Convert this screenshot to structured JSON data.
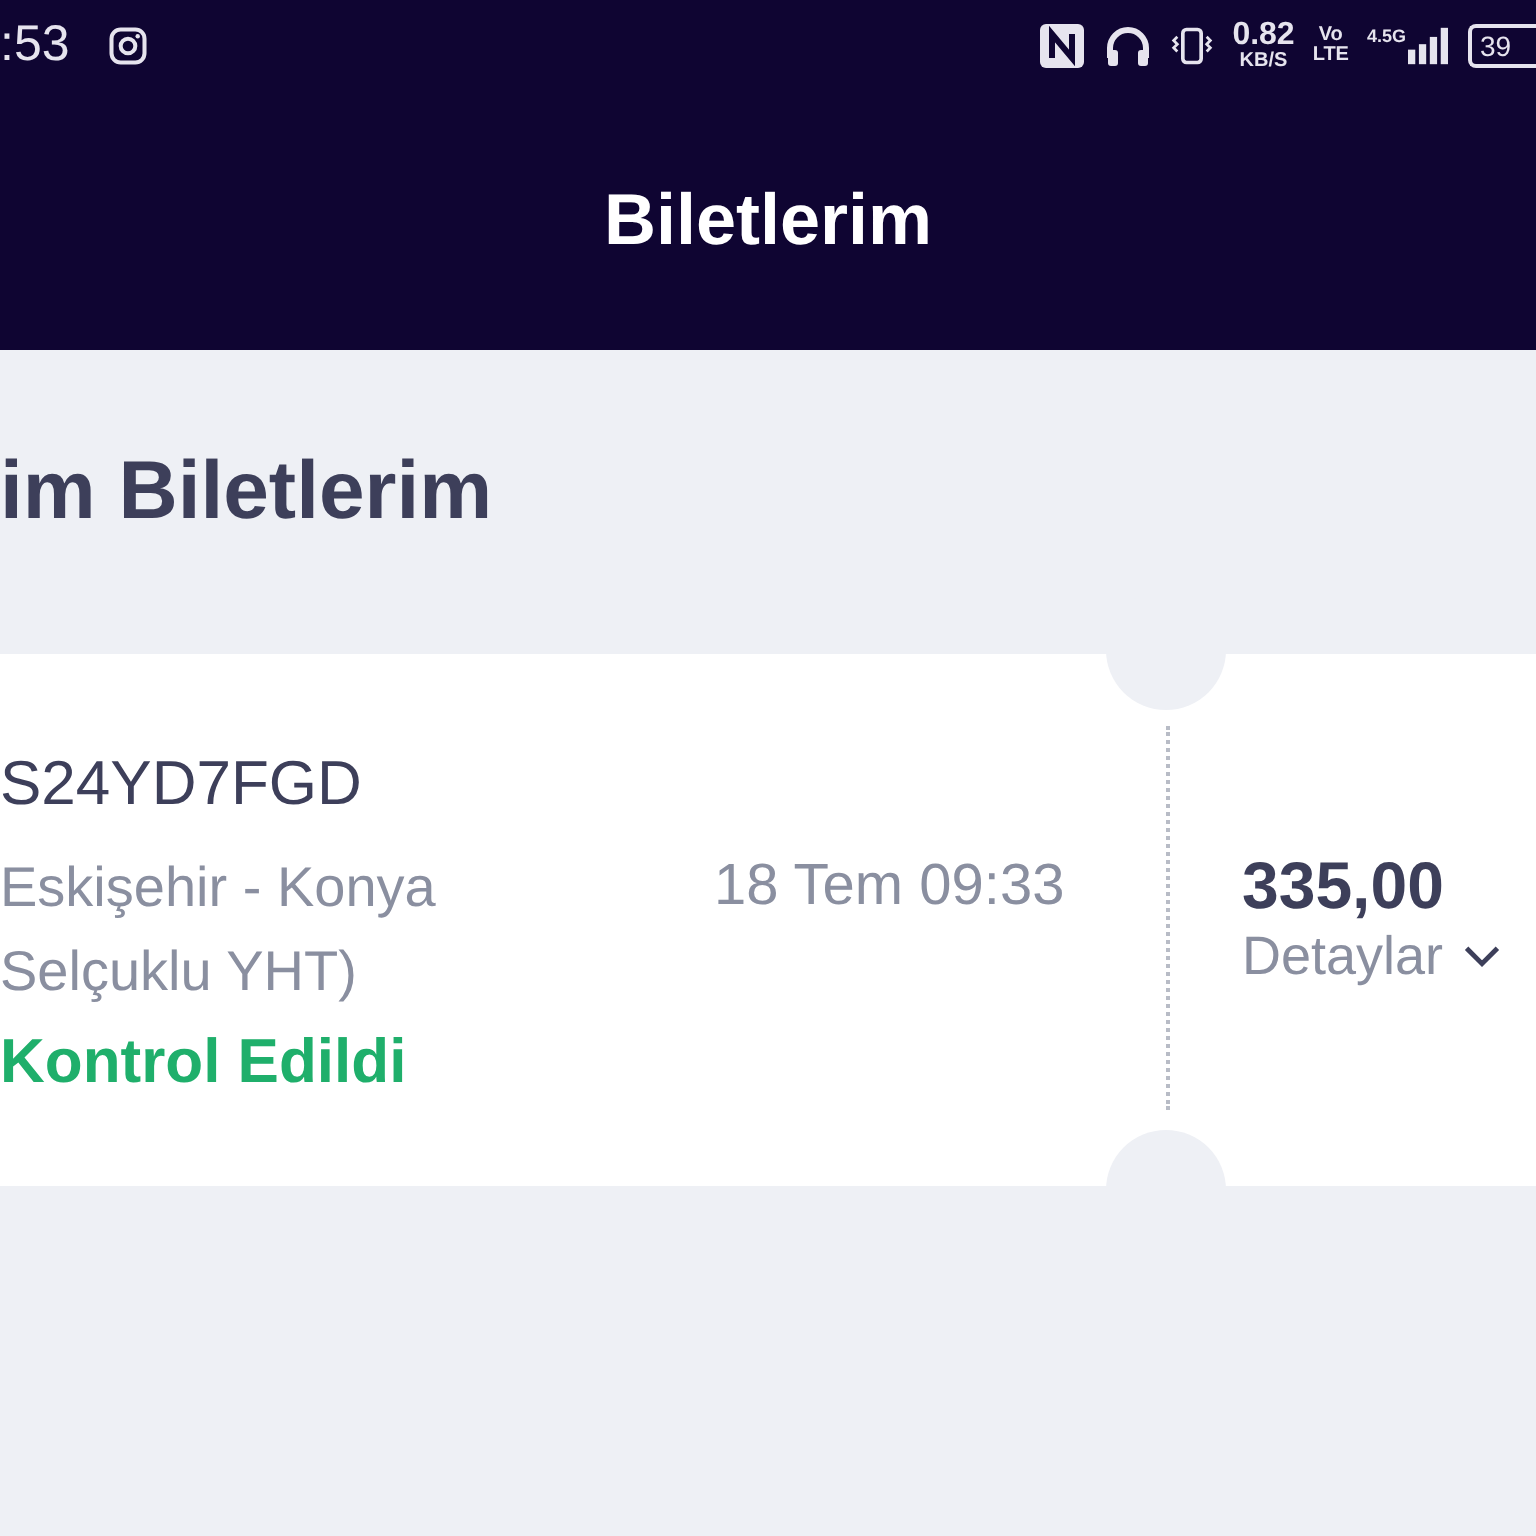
{
  "status_bar": {
    "time": ":53",
    "speed": "0.82",
    "speed_unit": "KB/S",
    "volte_top": "Vo",
    "volte_bottom": "LTE",
    "network": "4.5G",
    "battery": "39"
  },
  "header": {
    "title": "Biletlerim"
  },
  "section_title": "im Biletlerim",
  "tickets": [
    {
      "code": "S24YD7FGD",
      "route_lines": [
        "Eskişehir - Konya",
        "Selçuklu YHT)"
      ],
      "date": "18 Tem 09:33",
      "status": "Kontrol Edildi",
      "kind": "checked",
      "price": "335,00",
      "details": "Detaylar",
      "expanded": false
    }
  ]
}
